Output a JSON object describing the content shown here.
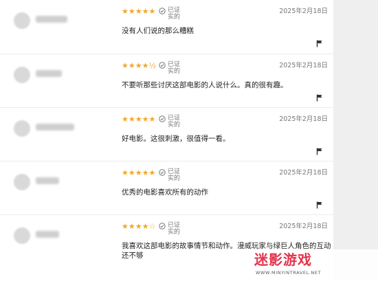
{
  "reviews": [
    {
      "username": "用户名已模糊",
      "stars": "★★★★★",
      "verified_line1": "已证",
      "verified_line2": "实的",
      "date": "2025年2月18日",
      "comment": "没有人们说的那么糟糕"
    },
    {
      "username": "用户名已模糊",
      "stars": "★★★★½",
      "verified_line1": "已证",
      "verified_line2": "实的",
      "date": "2025年2月18日",
      "comment": "不要听那些讨厌这部电影的人说什么。真的很有趣。"
    },
    {
      "username": "用户名已模糊",
      "stars": "★★★★★",
      "verified_line1": "已证",
      "verified_line2": "实的",
      "date": "2025年2月18日",
      "comment": "好电影。这很刺激，很值得一看。"
    },
    {
      "username": "用户名已模糊",
      "stars": "★★★★★",
      "verified_line1": "已证",
      "verified_line2": "实的",
      "date": "2025年2月18日",
      "comment": "优秀的电影喜欢所有的动作"
    },
    {
      "username": "用户名已模糊",
      "stars": "★★★★☆",
      "verified_line1": "已证",
      "verified_line2": "实的",
      "date": "2025年2月18日",
      "comment": "我喜欢这部电影的故事情节和动作。漫威玩家与绿巨人角色的互动还不够"
    }
  ],
  "watermark": {
    "logo": "迷影游戏",
    "url": "WWW.MINYINTRAVEL.NET"
  },
  "colors": {
    "star": "#f5a623",
    "brand": "#e6324b"
  }
}
